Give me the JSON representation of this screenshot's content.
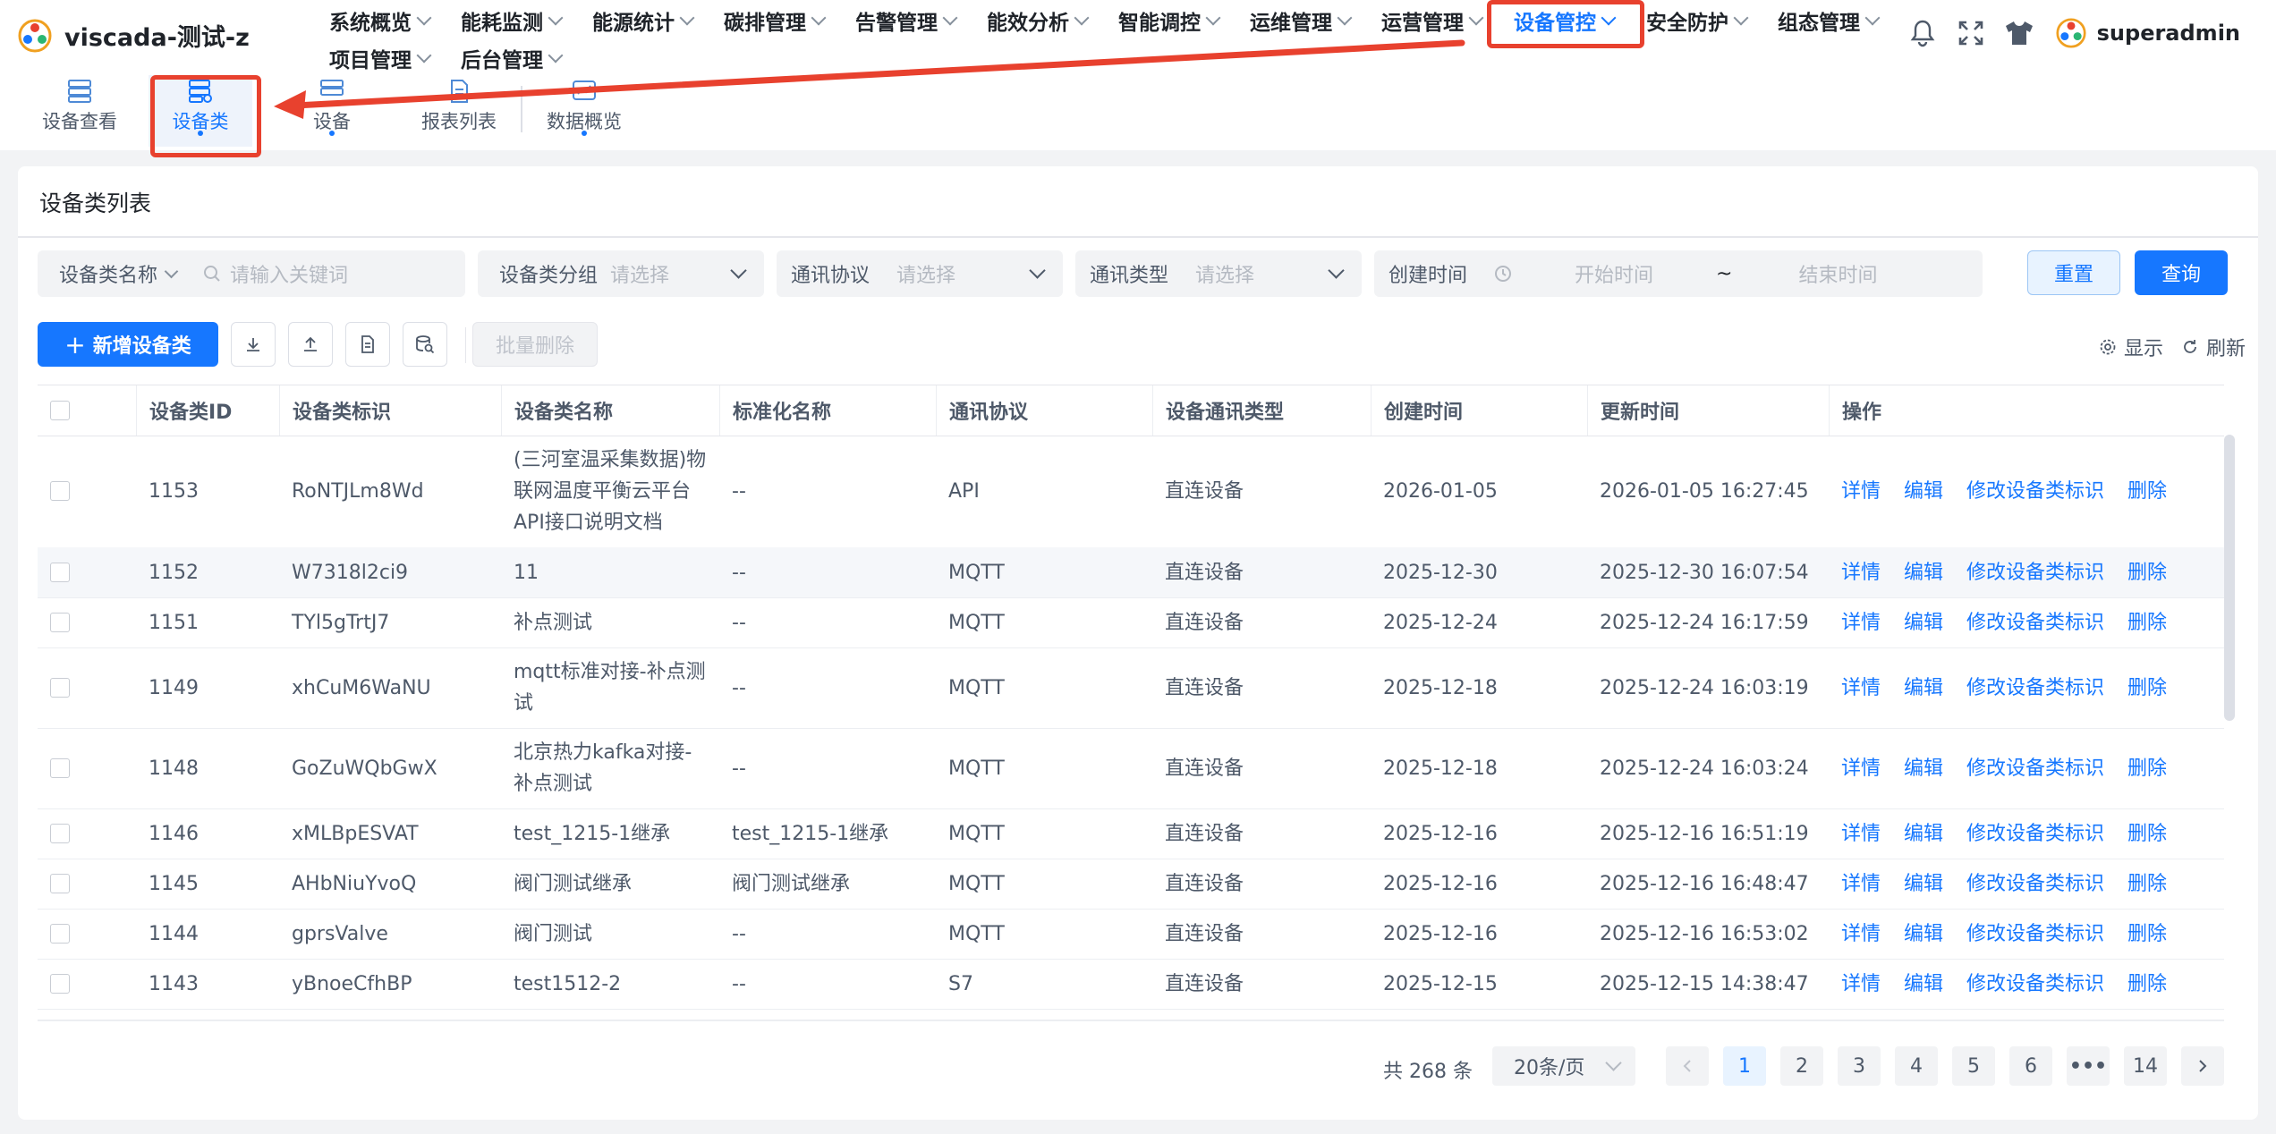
{
  "app": {
    "title": "viscada-测试-z"
  },
  "nav": {
    "items": [
      {
        "label": "系统概览"
      },
      {
        "label": "能耗监测"
      },
      {
        "label": "能源统计"
      },
      {
        "label": "碳排管理"
      },
      {
        "label": "告警管理"
      },
      {
        "label": "能效分析"
      },
      {
        "label": "智能调控"
      },
      {
        "label": "运维管理"
      },
      {
        "label": "运营管理"
      },
      {
        "label": "设备管控"
      },
      {
        "label": "安全防护"
      },
      {
        "label": "组态管理"
      },
      {
        "label": "项目管理"
      },
      {
        "label": "后台管理"
      }
    ],
    "active": "设备管控"
  },
  "header": {
    "username": "superadmin"
  },
  "subnav": {
    "items": [
      {
        "label": "设备查看"
      },
      {
        "label": "设备类"
      },
      {
        "label": "设备"
      },
      {
        "label": "报表列表"
      },
      {
        "label": "数据概览"
      }
    ],
    "active": "设备类"
  },
  "page": {
    "title": "设备类列表"
  },
  "filters": {
    "name_label": "设备类名称",
    "keyword_placeholder": "请输入关键词",
    "group_label": "设备类分组",
    "group_placeholder": "请选择",
    "protocol_label": "通讯协议",
    "protocol_placeholder": "请选择",
    "comm_type_label": "通讯类型",
    "comm_type_placeholder": "请选择",
    "created_label": "创建时间",
    "start_placeholder": "开始时间",
    "range_sep": "~",
    "end_placeholder": "结束时间",
    "reset": "重置",
    "query": "查询"
  },
  "toolbar": {
    "add": "新增设备类",
    "batch_delete": "批量删除",
    "display": "显示",
    "refresh": "刷新"
  },
  "table": {
    "columns": [
      "设备类ID",
      "设备类标识",
      "设备类名称",
      "标准化名称",
      "通讯协议",
      "设备通讯类型",
      "创建时间",
      "更新时间",
      "操作"
    ],
    "actions": [
      "详情",
      "编辑",
      "修改设备类标识",
      "删除"
    ],
    "rows": [
      {
        "id": "1153",
        "key": "RoNTJLm8Wd",
        "name": "(三河室温采集数据)物联网温度平衡云平台 API接口说明文档",
        "std": "--",
        "protocol": "API",
        "comm": "直连设备",
        "created": "2026-01-05",
        "updated": "2026-01-05 16:27:45"
      },
      {
        "id": "1152",
        "key": "W7318l2ci9",
        "name": "11",
        "std": "--",
        "protocol": "MQTT",
        "comm": "直连设备",
        "created": "2025-12-30",
        "updated": "2025-12-30 16:07:54"
      },
      {
        "id": "1151",
        "key": "TYl5gTrtJ7",
        "name": "补点测试",
        "std": "--",
        "protocol": "MQTT",
        "comm": "直连设备",
        "created": "2025-12-24",
        "updated": "2025-12-24 16:17:59"
      },
      {
        "id": "1149",
        "key": "xhCuM6WaNU",
        "name": "mqtt标准对接-补点测试",
        "std": "--",
        "protocol": "MQTT",
        "comm": "直连设备",
        "created": "2025-12-18",
        "updated": "2025-12-24 16:03:19"
      },
      {
        "id": "1148",
        "key": "GoZuWQbGwX",
        "name": "北京热力kafka对接-补点测试",
        "std": "--",
        "protocol": "MQTT",
        "comm": "直连设备",
        "created": "2025-12-18",
        "updated": "2025-12-24 16:03:24"
      },
      {
        "id": "1146",
        "key": "xMLBpESVAT",
        "name": "test_1215-1继承",
        "std": "test_1215-1继承",
        "protocol": "MQTT",
        "comm": "直连设备",
        "created": "2025-12-16",
        "updated": "2025-12-16 16:51:19"
      },
      {
        "id": "1145",
        "key": "AHbNiuYvoQ",
        "name": "阀门测试继承",
        "std": "阀门测试继承",
        "protocol": "MQTT",
        "comm": "直连设备",
        "created": "2025-12-16",
        "updated": "2025-12-16 16:48:47"
      },
      {
        "id": "1144",
        "key": "gprsValve",
        "name": "阀门测试",
        "std": "--",
        "protocol": "MQTT",
        "comm": "直连设备",
        "created": "2025-12-16",
        "updated": "2025-12-16 16:53:02"
      },
      {
        "id": "1143",
        "key": "yBnoeCfhBP",
        "name": "test1512-2",
        "std": "--",
        "protocol": "S7",
        "comm": "直连设备",
        "created": "2025-12-15",
        "updated": "2025-12-15 14:38:47"
      }
    ]
  },
  "pagination": {
    "total": "共 268 条",
    "page_size": "20条/页",
    "pages": [
      "1",
      "2",
      "3",
      "4",
      "5",
      "6",
      "•••",
      "14"
    ],
    "current": "1"
  },
  "colors": {
    "primary": "#1677ff",
    "annotation": "#e8412e"
  }
}
